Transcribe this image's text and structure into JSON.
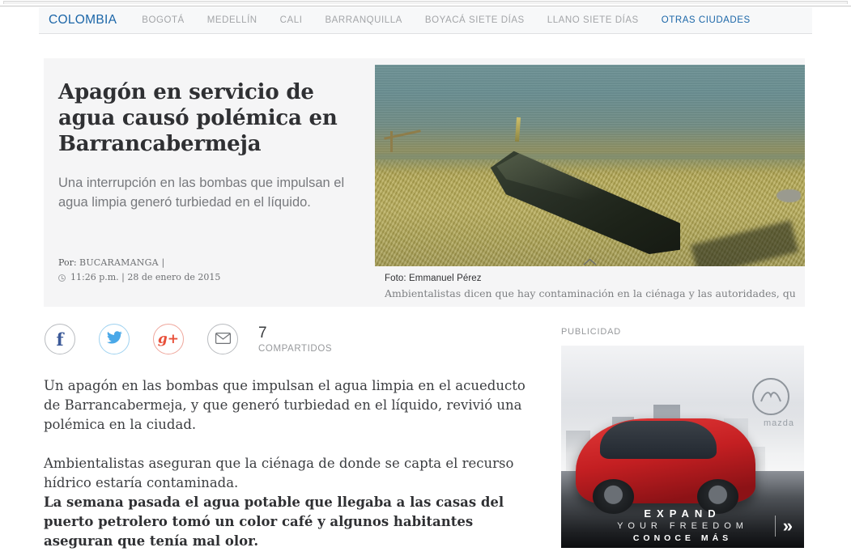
{
  "nav": {
    "items": [
      {
        "label": "COLOMBIA",
        "state": "active"
      },
      {
        "label": "BOGOTÁ",
        "state": "normal"
      },
      {
        "label": "MEDELLÍN",
        "state": "normal"
      },
      {
        "label": "CALI",
        "state": "normal"
      },
      {
        "label": "BARRANQUILLA",
        "state": "normal"
      },
      {
        "label": "BOYACÁ SIETE DÍAS",
        "state": "normal"
      },
      {
        "label": "LLANO SIETE DÍAS",
        "state": "normal"
      },
      {
        "label": "OTRAS CIUDADES",
        "state": "link"
      }
    ],
    "accent_color": "#1b66a8",
    "muted_color": "#a3a5a8"
  },
  "article": {
    "headline": "Apagón en servicio de agua causó polémica en Barrancabermeja",
    "standfirst": "Una interrupción en las bombas que impulsan el agua limpia generó turbiedad en el líquido.",
    "byline_label": "Por:",
    "byline_source": "BUCARAMANGA |",
    "clock_icon": "clock-icon",
    "timestamp": "11:26 p.m. | 28 de enero de 2015",
    "photo_credit": "Foto: Emmanuel Pérez",
    "photo_caption": "Ambientalistas dicen que hay contaminación en la ciénaga y las autoridades, que son falla…",
    "caption_toggle_icon": "chevron-up-icon",
    "body": [
      {
        "text": "Un apagón en las bombas que impulsan el agua limpia en el acueducto de Barrancabermeja, y que generó turbiedad en el líquido, revivió una polémica en la ciudad.",
        "style": "normal"
      },
      {
        "text": "Ambientalistas aseguran que la ciénaga de donde se capta el recurso hídrico estaría contaminada.",
        "style": "tight"
      },
      {
        "text": "La semana pasada el agua potable que llegaba a las casas del puerto petrolero tomó un color café y algunos habitantes aseguran que tenía mal olor.",
        "style": "bold"
      }
    ]
  },
  "share": {
    "buttons": [
      {
        "name": "facebook",
        "icon": "facebook-icon",
        "glyph": "f",
        "color": "#3b5998"
      },
      {
        "name": "twitter",
        "icon": "twitter-icon",
        "glyph": "🐦",
        "color": "#4aa8e8"
      },
      {
        "name": "googleplus",
        "icon": "google-plus-icon",
        "glyph": "g+",
        "color": "#e8503a"
      },
      {
        "name": "email",
        "icon": "envelope-icon",
        "glyph": "✉",
        "color": "#6f7276"
      }
    ],
    "count": "7",
    "count_label": "COMPARTIDOS"
  },
  "ad": {
    "label": "PUBLICIDAD",
    "brand": "mazda",
    "logo_glyph": "〜",
    "cta_line1": "EXPAND",
    "cta_line2": "YOUR FREEDOM",
    "cta_line3": "CONOCE MÁS",
    "arrow_glyph": "»"
  }
}
